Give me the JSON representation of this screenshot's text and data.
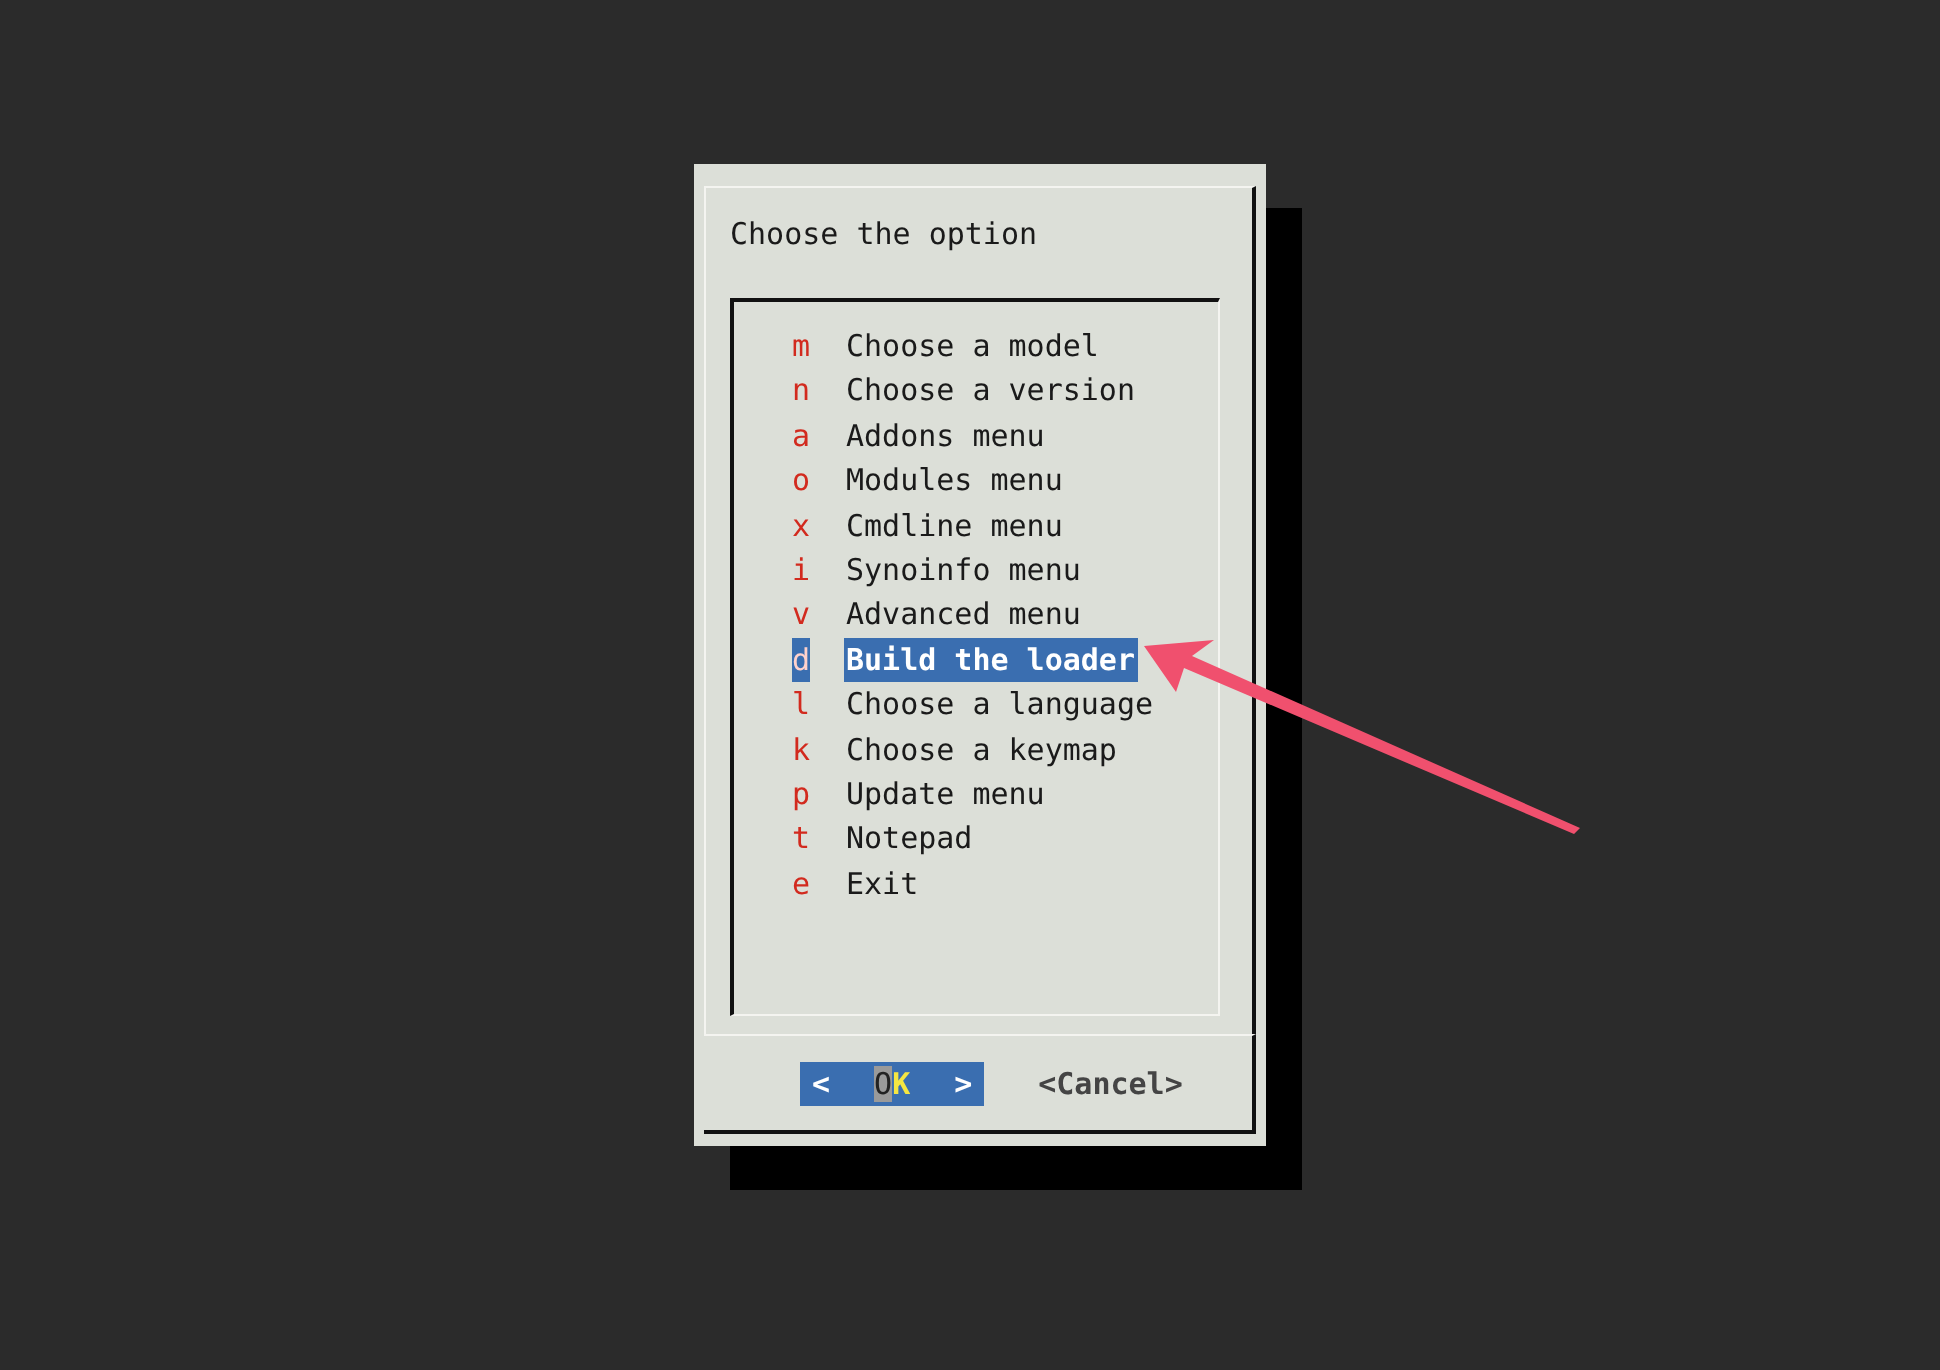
{
  "dialog": {
    "title": "Choose the option",
    "items": [
      {
        "key": "m",
        "label": "Choose a model",
        "selected": false
      },
      {
        "key": "n",
        "label": "Choose a version",
        "selected": false
      },
      {
        "key": "a",
        "label": "Addons menu",
        "selected": false
      },
      {
        "key": "o",
        "label": "Modules menu",
        "selected": false
      },
      {
        "key": "x",
        "label": "Cmdline menu",
        "selected": false
      },
      {
        "key": "i",
        "label": "Synoinfo menu",
        "selected": false
      },
      {
        "key": "v",
        "label": "Advanced menu",
        "selected": false
      },
      {
        "key": "d",
        "label": "Build the loader",
        "selected": true
      },
      {
        "key": "l",
        "label": "Choose a language",
        "selected": false
      },
      {
        "key": "k",
        "label": "Choose a keymap",
        "selected": false
      },
      {
        "key": "p",
        "label": "Update menu",
        "selected": false
      },
      {
        "key": "t",
        "label": "Notepad",
        "selected": false
      },
      {
        "key": "e",
        "label": "Exit",
        "selected": false
      }
    ],
    "buttons": [
      {
        "open": "<",
        "label": "OK",
        "close": ">",
        "selected": true
      },
      {
        "open": "<",
        "label": "Cancel",
        "close": ">",
        "selected": false
      }
    ]
  }
}
